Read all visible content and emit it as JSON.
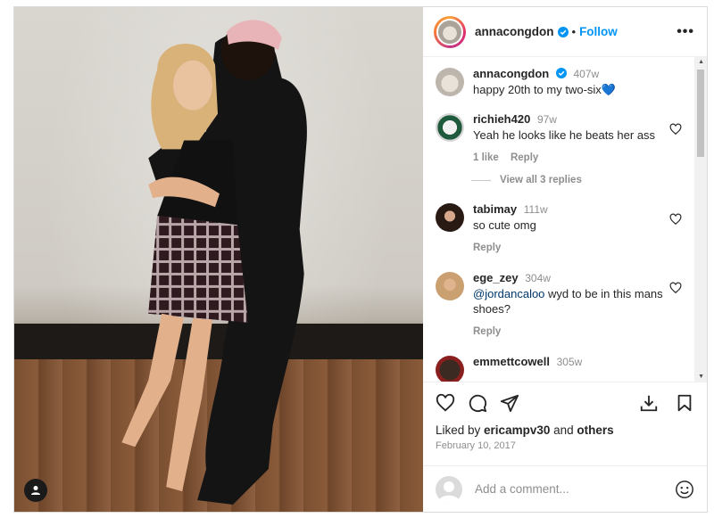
{
  "post": {
    "username": "annacongdon",
    "follow_label": "Follow",
    "dot": "•",
    "more_label": "•••"
  },
  "comments": [
    {
      "user": "annacongdon",
      "time": "407w",
      "text": "happy 20th to my two-six💙",
      "verified": true
    },
    {
      "user": "richieh420",
      "time": "97w",
      "text": "Yeah he looks like he beats her ass",
      "likes": "1 like",
      "reply": "Reply"
    },
    {
      "user": "tabimay",
      "time": "111w",
      "text": "so cute omg",
      "reply": "Reply"
    },
    {
      "user": "ege_zey",
      "time": "304w",
      "mention": "@jordancaloo",
      "text": " wyd to be in this mans shoes?",
      "reply": "Reply"
    },
    {
      "user": "emmettcowell",
      "time": "305w"
    }
  ],
  "view_replies": "View all 3 replies",
  "likes": {
    "prefix": "Liked by ",
    "user": "ericampv30",
    "middle": " and ",
    "others": "others"
  },
  "date": "February 10, 2017",
  "add_comment": {
    "placeholder": "Add a comment..."
  },
  "colors": {
    "accent": "#0095f6",
    "verified": "#0095f6"
  }
}
